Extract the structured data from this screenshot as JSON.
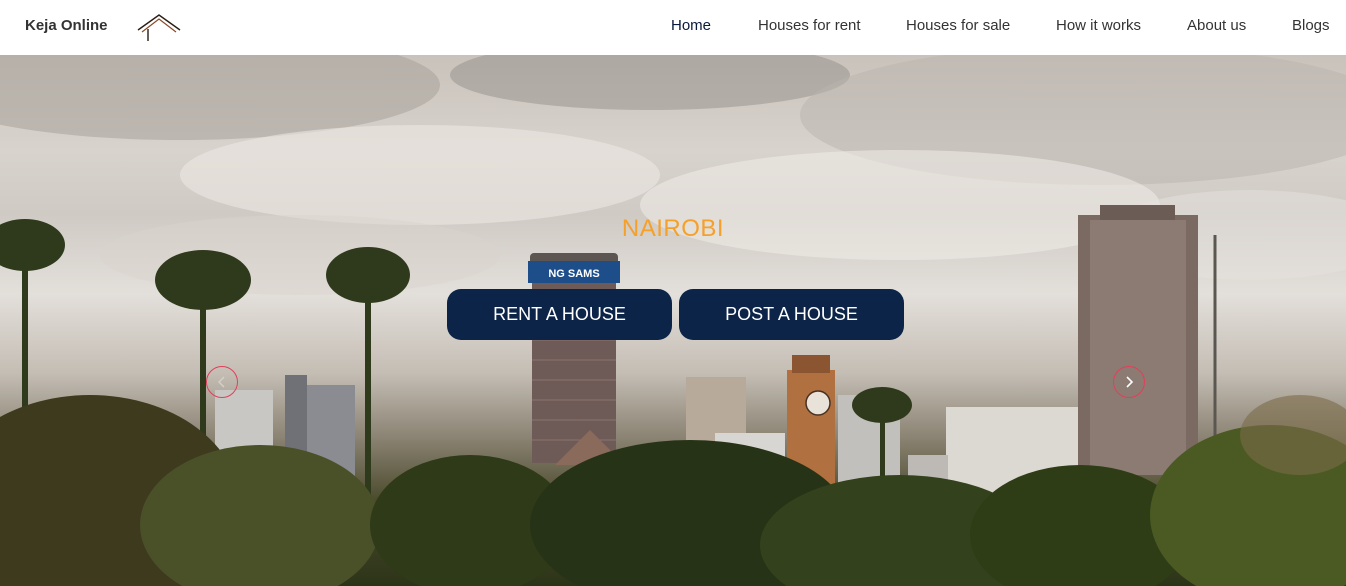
{
  "header": {
    "brand": "Keja Online",
    "logo_icon": "house-roof-icon",
    "nav": {
      "home": "Home",
      "rent": "Houses for rent",
      "sale": "Houses for sale",
      "how": "How it works",
      "about": "About us",
      "blogs": "Blogs"
    }
  },
  "hero": {
    "title": "NAIROBI",
    "rent_button": "RENT A HOUSE",
    "post_button": "POST A HOUSE",
    "prev_icon": "chevron-left-icon",
    "next_icon": "chevron-right-icon",
    "billboard_text": "NG SAMS"
  },
  "colors": {
    "accent_orange": "#f5a02a",
    "button_navy": "#0b2447",
    "arrow_red": "#e0405a"
  }
}
